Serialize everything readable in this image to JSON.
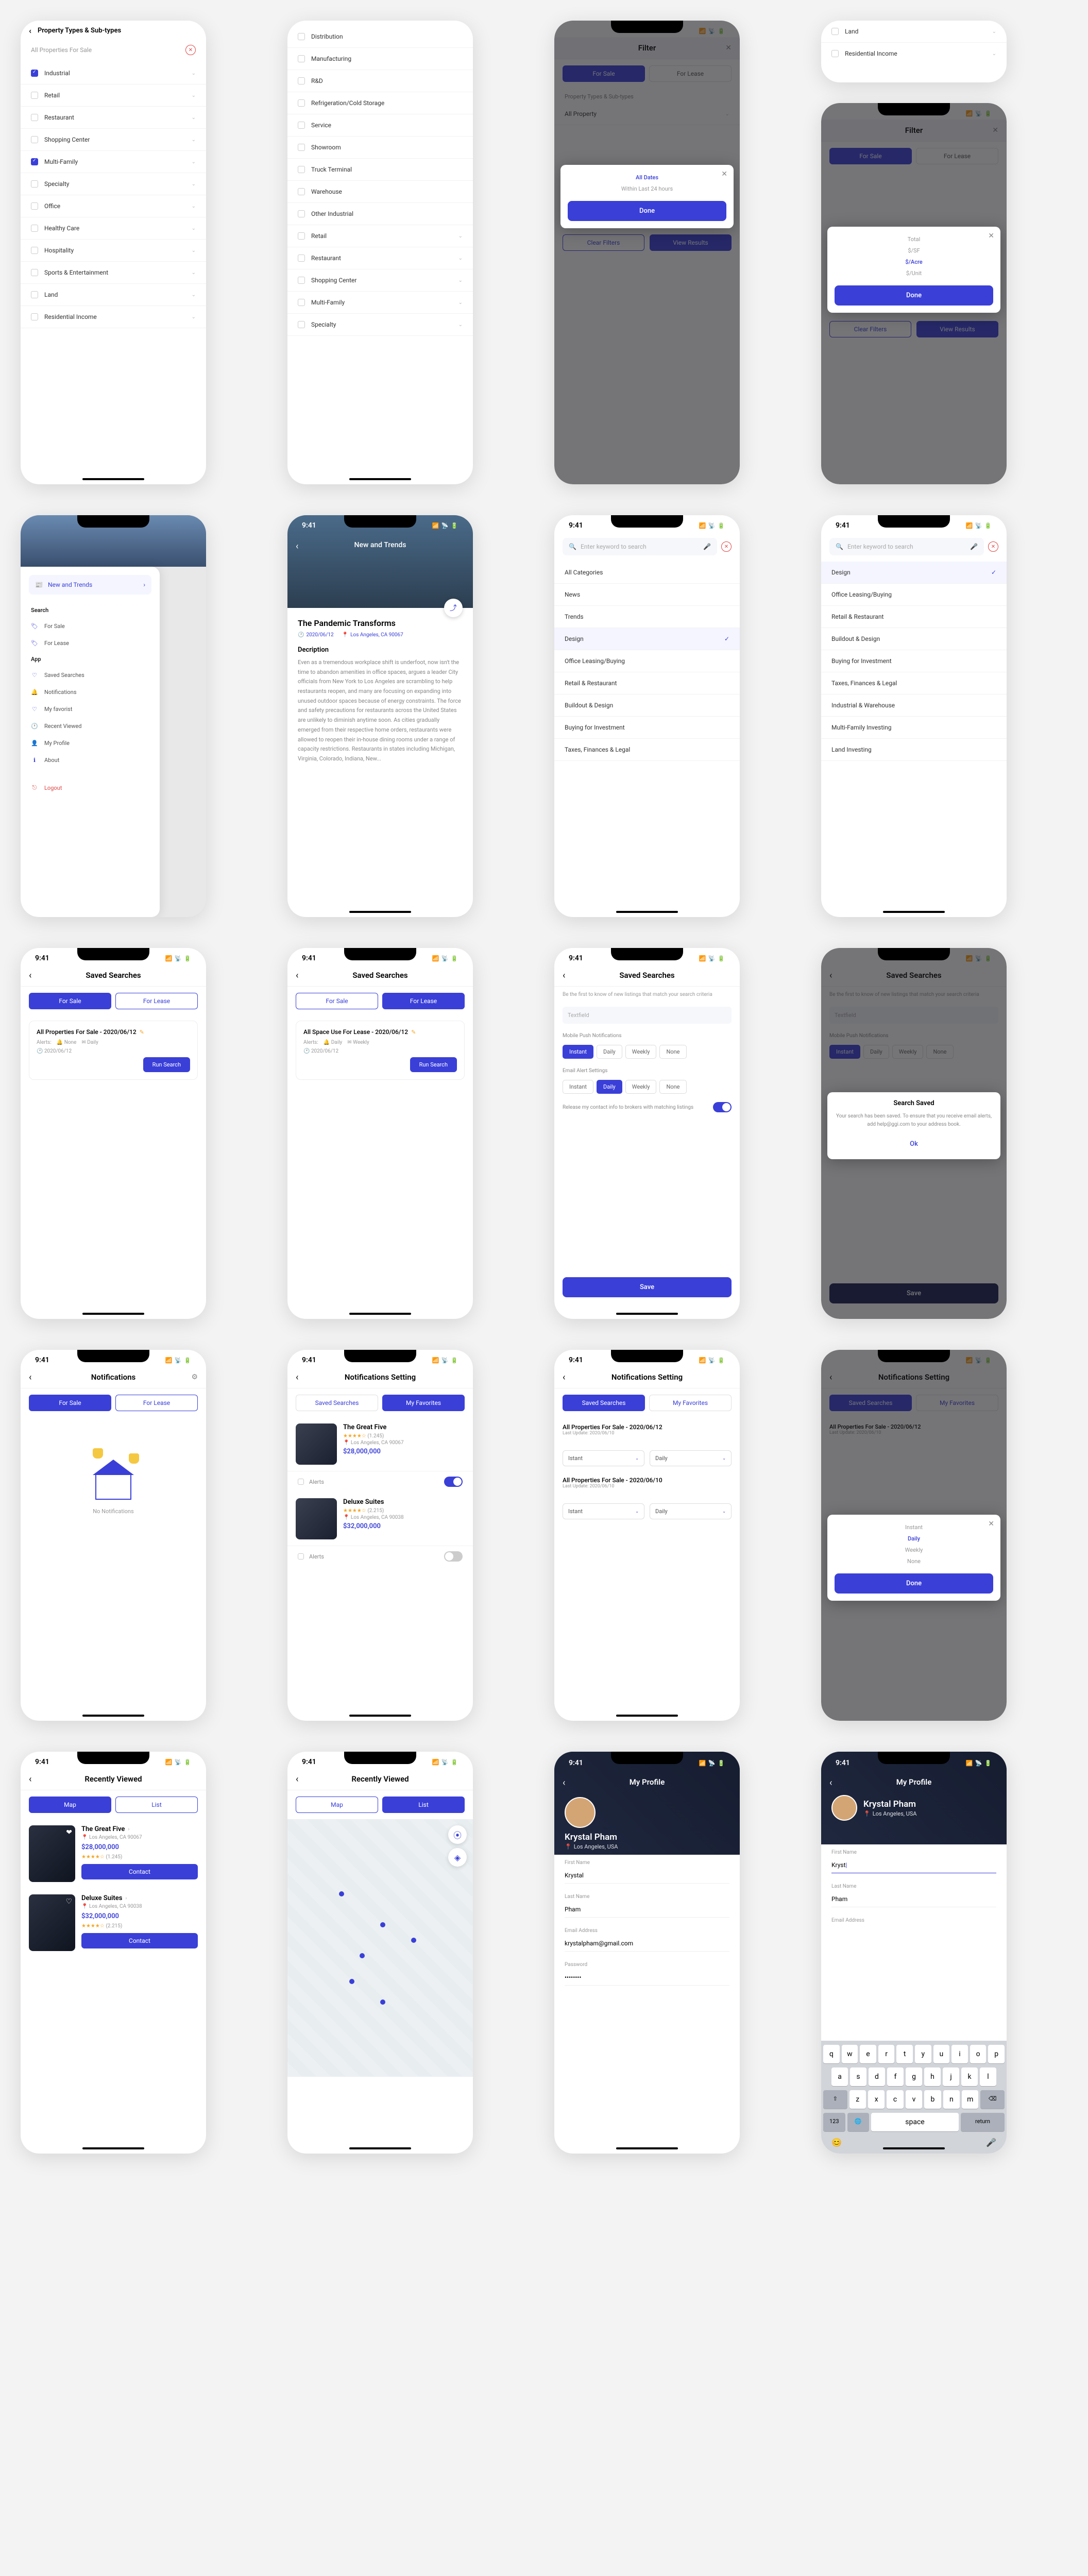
{
  "time": "9:41",
  "propertyTypes": {
    "title": "Property Types & Sub-types",
    "allLabel": "All Properties For Sale",
    "items": [
      {
        "label": "Industrial",
        "checked": true
      },
      {
        "label": "Retail",
        "checked": false
      },
      {
        "label": "Restaurant",
        "checked": false
      },
      {
        "label": "Shopping Center",
        "checked": false
      },
      {
        "label": "Multi-Family",
        "checked": true
      },
      {
        "label": "Specialty",
        "checked": false
      },
      {
        "label": "Office",
        "checked": false
      },
      {
        "label": "Healthy Care",
        "checked": false
      },
      {
        "label": "Hospitality",
        "checked": false
      },
      {
        "label": "Sports & Entertainment",
        "checked": false
      },
      {
        "label": "Land",
        "checked": false
      },
      {
        "label": "Residential Income",
        "checked": false
      }
    ]
  },
  "subtypes": {
    "items": [
      "Distribution",
      "Manufacturing",
      "R&D",
      "Refrigeration/Cold Storage",
      "Service",
      "Showroom",
      "Truck Terminal",
      "Warehouse",
      "Other Industrial"
    ],
    "main": [
      "Retail",
      "Restaurant",
      "Shopping Center",
      "Multi-Family",
      "Specialty"
    ]
  },
  "filter": {
    "title": "Filter",
    "forSale": "For Sale",
    "forLease": "For Lease",
    "ptSub": "Property Types & Sub-types",
    "allProperty": "All Property",
    "clear": "Clear Filters",
    "view": "View Results",
    "allDates": "All Dates",
    "within24": "Within Last 24 hours",
    "done": "Done",
    "priceOptions": [
      "Total",
      "$/SF",
      "$/Acre",
      "$/Unit"
    ],
    "selectedPrice": "$/Acre",
    "land": "Land",
    "residential": "Residential Income"
  },
  "sidebar": {
    "news": "New and Trends",
    "search": "Search",
    "searchItems": [
      "For Sale",
      "For Lease"
    ],
    "app": "App",
    "appItems": [
      "Saved Searches",
      "Notifications",
      "My favorist",
      "Recent Viewed",
      "My Profile",
      "About"
    ],
    "logout": "Logout"
  },
  "article": {
    "category": "New and Trends",
    "title": "The Pandemic Transforms",
    "date": "2020/06/12",
    "location": "Los Angeles, CA 90067",
    "descHeading": "Decription",
    "body": "Even as a tremendous workplace shift is underfoot, now isn't the time to abandon amenities in office spaces, argues a leader City officials from New York to Los Angeles are scrambling to help restaurants reopen, and many are focusing on expanding into unused outdoor spaces because of energy constraints. The force and safety precautions for restaurants across the United States are unlikely to diminish anytime soon. As cities gradually emerged from their respective home orders, restaurants were allowed to reopen their in-house dining rooms under a range of capacity restrictions. Restaurants in states including Michigan, Virginia, Colorado, Indiana, New..."
  },
  "categories": {
    "placeholder": "Enter keyword to search",
    "all": "All Categories",
    "items": [
      "News",
      "Trends",
      "Design",
      "Office Leasing/Buying",
      "Retail & Restaurant",
      "Buildout & Design",
      "Buying for Investment",
      "Taxes, Finances & Legal"
    ],
    "selected": "Design",
    "extra": [
      "Industrial & Warehouse",
      "Multi-Family Investing",
      "Land Investing"
    ]
  },
  "savedSearches": {
    "title": "Saved Searches",
    "forSale": "For Sale",
    "forLease": "For Lease",
    "card1Title": "All Properties For Sale - 2020/06/12",
    "card2Title": "All Space Use For Lease - 2020/06/12",
    "alerts": "Alerts:",
    "none": "None",
    "daily": "Daily",
    "weekly": "Weekly",
    "date": "2020/06/12",
    "run": "Run Search",
    "intro": "Be the first to know of new listings that match your search criteria",
    "textfield": "Textfield",
    "mobilePush": "Mobile Push Notifications",
    "emailAlert": "Email Alert Settings",
    "freqOptions": [
      "Instant",
      "Daily",
      "Weekly",
      "None"
    ],
    "release": "Release my contact info to brokers with matching listings",
    "save": "Save",
    "savedTitle": "Search Saved",
    "savedBody": "Your search has been saved. To ensure that you receive email alerts, add help@ggi.com to your address book.",
    "ok": "Ok"
  },
  "notifications": {
    "title": "Notifications",
    "setting": "Notifications Setting",
    "savedTab": "Saved Searches",
    "favTab": "My Favorites",
    "empty": "No Notifications",
    "listings": [
      {
        "name": "The Great Five",
        "rating": "★★★★☆",
        "count": "(1.245)",
        "loc": "Los Angeles, CA 90067",
        "price": "$28,000,000"
      },
      {
        "name": "Deluxe Suites",
        "rating": "★★★★☆",
        "count": "(2.215)",
        "loc": "Los Angeles, CA 90038",
        "price": "$32,000,000"
      }
    ],
    "alertsLabel": "Alerts",
    "searchItems": [
      {
        "title": "All Properties For Sale - 2020/06/12",
        "sub": "Last Update: 2020/06/10",
        "f1": "Istant",
        "f2": "Daily"
      },
      {
        "title": "All Properties For Sale - 2020/06/10",
        "sub": "Last Update: 2020/06/10",
        "f1": "Istant",
        "f2": "Daily"
      }
    ],
    "freqModal": [
      "Instant",
      "Daily",
      "Weekly",
      "None"
    ],
    "freqSelected": "Daily",
    "done": "Done"
  },
  "recentlyViewed": {
    "title": "Recently Viewed",
    "map": "Map",
    "list": "List",
    "contact": "Contact"
  },
  "profile": {
    "title": "My Profile",
    "name": "Krystal Pham",
    "loc": "Los Angeles, USA",
    "firstName": "First Name",
    "fnVal": "Krystal",
    "fnValTyping": "Kryst",
    "lastName": "Last Name",
    "lnVal": "Pham",
    "email": "Email Address",
    "emailVal": "krystalpham@gmail.com",
    "password": "Password",
    "pwVal": "••••••••"
  },
  "keyboard": {
    "r1": [
      "q",
      "w",
      "e",
      "r",
      "t",
      "y",
      "u",
      "i",
      "o",
      "p"
    ],
    "r2": [
      "a",
      "s",
      "d",
      "f",
      "g",
      "h",
      "j",
      "k",
      "l"
    ],
    "r3": [
      "z",
      "x",
      "c",
      "v",
      "b",
      "n",
      "m"
    ],
    "shift": "⇧",
    "del": "⌫",
    "num": "123",
    "globe": "🌐",
    "space": "space",
    "ret": "return",
    "emoji": "😊",
    "mic": "🎤"
  }
}
